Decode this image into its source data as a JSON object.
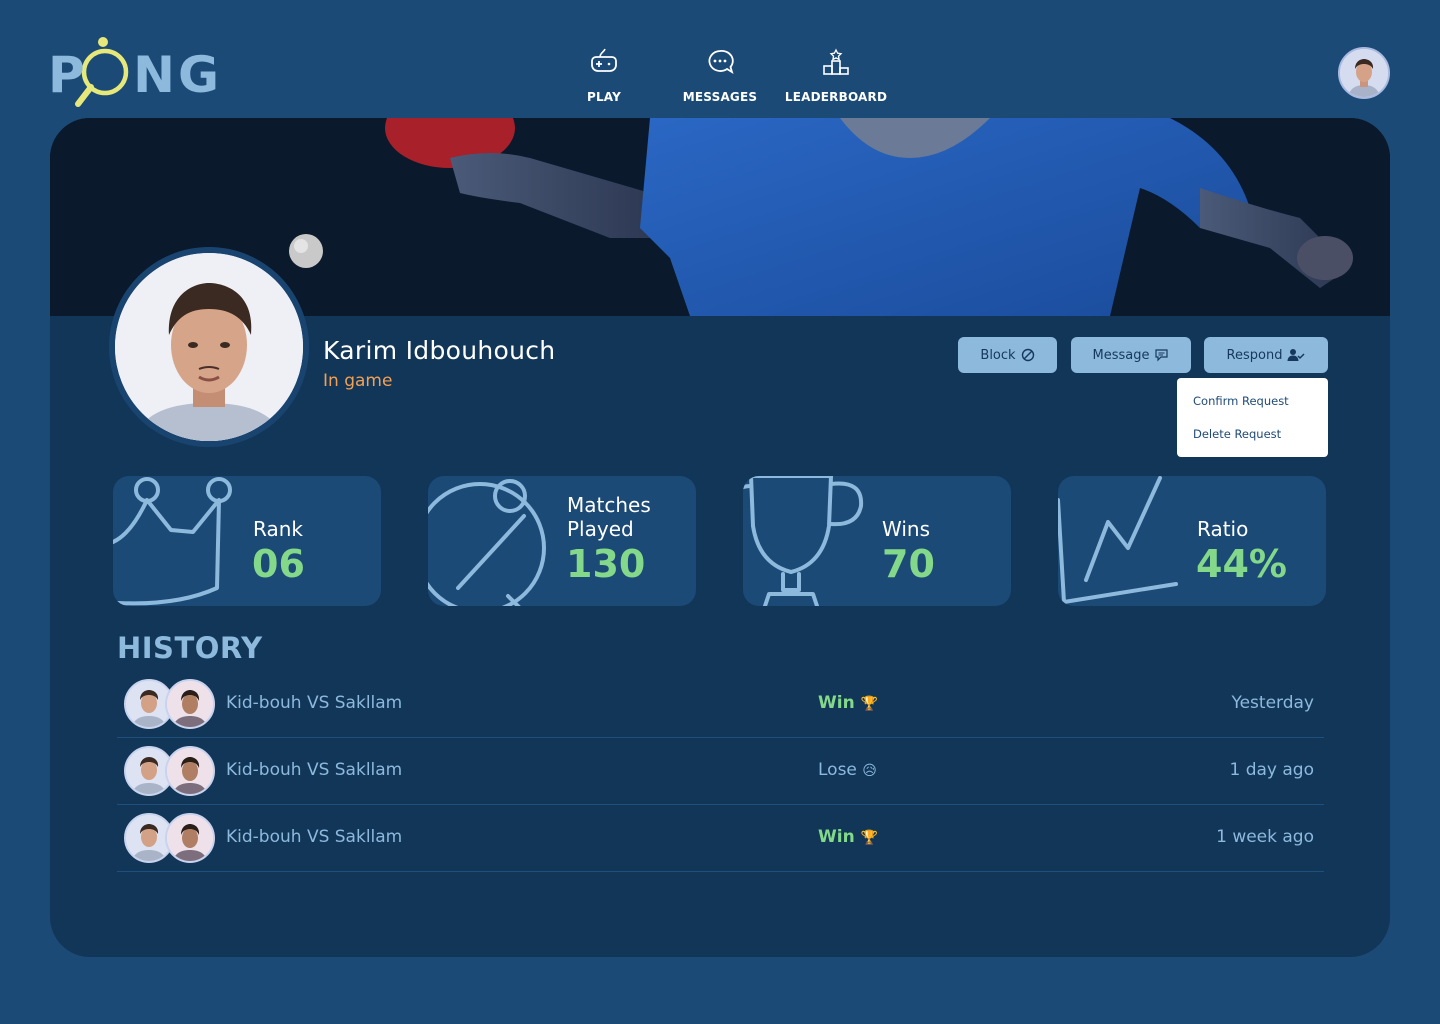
{
  "app": {
    "logo_text": "PONG"
  },
  "nav": {
    "play": {
      "label": "PLAY",
      "icon": "gamepad-icon"
    },
    "messages": {
      "label": "MESSAGES",
      "icon": "chat-bubble-icon"
    },
    "leaderboard": {
      "label": "LEADERBOARD",
      "icon": "podium-icon"
    }
  },
  "profile": {
    "name": "Karim Idbouhouch",
    "status": "In game"
  },
  "actions": {
    "block_label": "Block",
    "message_label": "Message",
    "respond_label": "Respond"
  },
  "respond_menu": {
    "items": [
      "Confirm Request",
      "Delete Request"
    ]
  },
  "stats": {
    "rank": {
      "label": "Rank",
      "value": "06"
    },
    "matches": {
      "label_line1": "Matches",
      "label_line2": "Played",
      "value": "130"
    },
    "wins": {
      "label": "Wins",
      "value": "70"
    },
    "ratio": {
      "label": "Ratio",
      "value": "44%"
    }
  },
  "history": {
    "title": "HISTORY",
    "rows": [
      {
        "match": "Kid-bouh VS Sakllam",
        "result": "Win",
        "emoji": "🏆",
        "time": "Yesterday"
      },
      {
        "match": "Kid-bouh VS Sakllam",
        "result": "Lose",
        "emoji": "😥",
        "time": "1 day ago"
      },
      {
        "match": "Kid-bouh VS Sakllam",
        "result": "Win",
        "emoji": "🏆",
        "time": "1 week ago"
      }
    ]
  },
  "colors": {
    "background": "#1b4a77",
    "card": "#123658",
    "accent_light": "#8db9dc",
    "win_green": "#84d88a",
    "status_orange": "#f4a053",
    "logo_yellow": "#e6e87a"
  }
}
